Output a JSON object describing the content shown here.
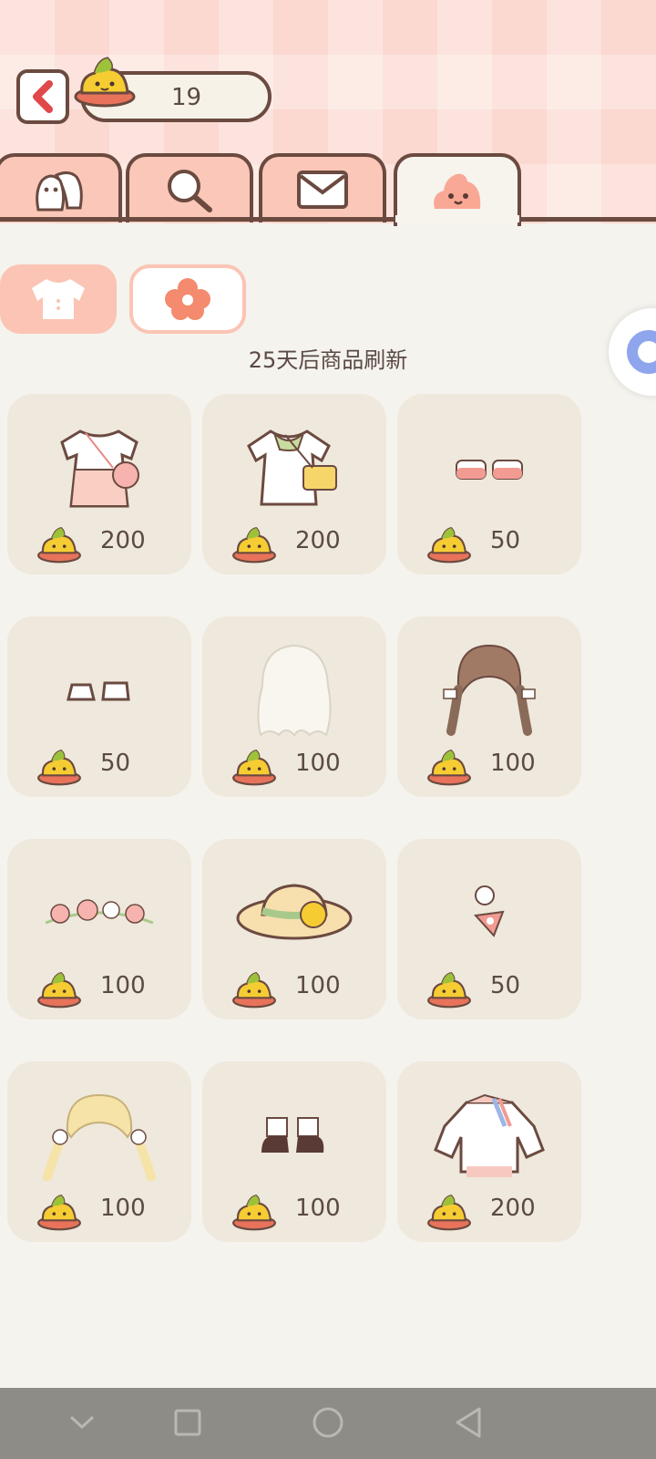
{
  "header": {
    "currency_value": "19"
  },
  "tabs": [
    {
      "name": "friends",
      "icon": "ghost-friends-icon",
      "active": false
    },
    {
      "name": "search",
      "icon": "magnifier-icon",
      "active": false
    },
    {
      "name": "mail",
      "icon": "envelope-icon",
      "active": false
    },
    {
      "name": "shop",
      "icon": "poop-icon",
      "active": true
    }
  ],
  "categories": [
    {
      "name": "clothes",
      "icon": "shirt-icon",
      "selected": true
    },
    {
      "name": "accessories",
      "icon": "flower-icon",
      "selected": false
    }
  ],
  "refresh_note": "25天后商品刷新",
  "items": [
    {
      "icon": "pink-dress-icon",
      "price": "200"
    },
    {
      "icon": "green-dress-bag-icon",
      "price": "200"
    },
    {
      "icon": "pink-shoes-icon",
      "price": "50"
    },
    {
      "icon": "white-shoes-icon",
      "price": "50"
    },
    {
      "icon": "white-wavy-hair-icon",
      "price": "100"
    },
    {
      "icon": "brown-braid-hair-icon",
      "price": "100"
    },
    {
      "icon": "flower-crown-icon",
      "price": "100"
    },
    {
      "icon": "straw-hat-icon",
      "price": "100"
    },
    {
      "icon": "hair-clip-icon",
      "price": "50"
    },
    {
      "icon": "blonde-pigtail-hair-icon",
      "price": "100"
    },
    {
      "icon": "brown-shoes-icon",
      "price": "100"
    },
    {
      "icon": "white-jacket-icon",
      "price": "200"
    }
  ],
  "colors": {
    "accent": "#fbc4b4",
    "outline": "#6b4a40",
    "card": "#efe8dc"
  }
}
